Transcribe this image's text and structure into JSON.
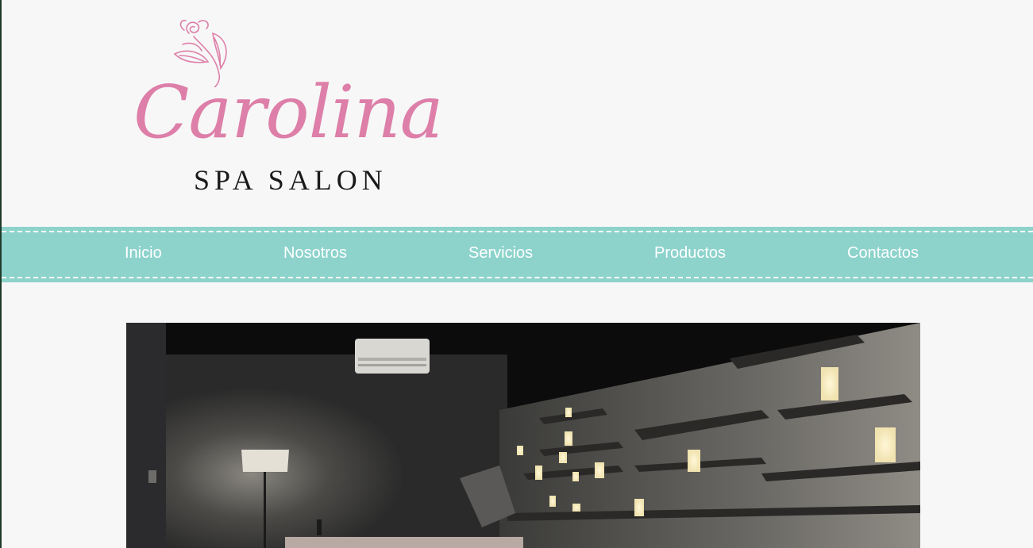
{
  "logo": {
    "script_text": "Carolina",
    "subtitle": "SPA SALON",
    "flower_icon": "rose-flower-icon",
    "brand_color": "#dd7fa8"
  },
  "nav": {
    "background_color": "#8dd3cc",
    "items": [
      {
        "label": "Inicio"
      },
      {
        "label": "Nosotros"
      },
      {
        "label": "Servicios"
      },
      {
        "label": "Productos"
      },
      {
        "label": "Contactos"
      }
    ]
  },
  "hero": {
    "image_icon": "spa-room-photo"
  }
}
